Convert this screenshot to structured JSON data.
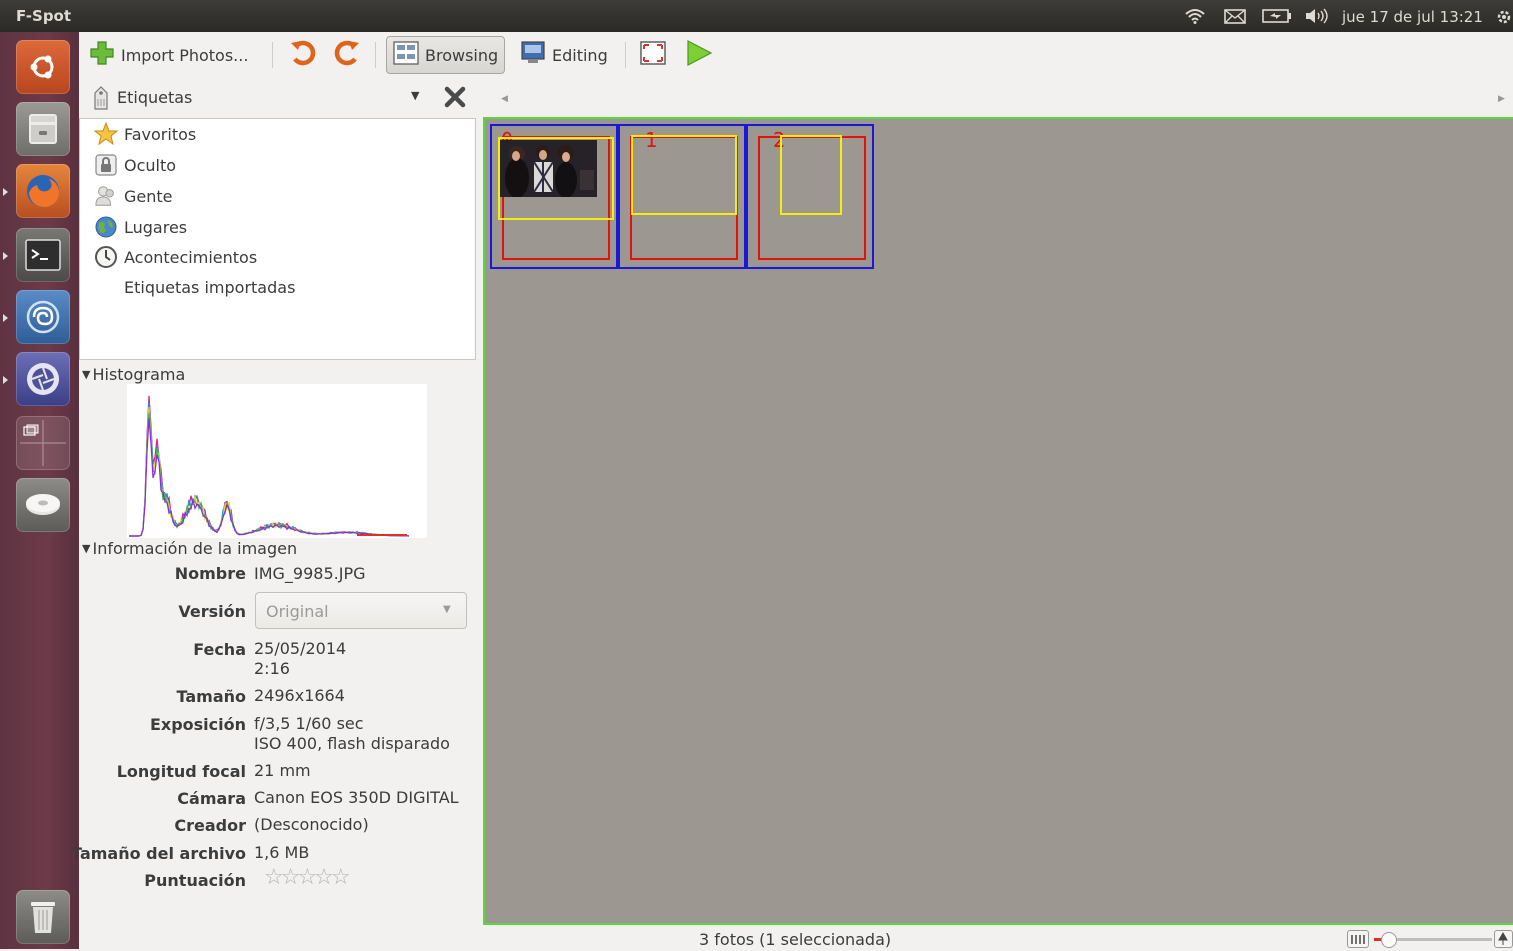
{
  "topbar": {
    "app_name": "F-Spot",
    "clock": "jue 17 de jul 13:21"
  },
  "launcher": {
    "items": [
      "ubuntu-home-icon",
      "file-cabinet-icon",
      "firefox-icon",
      "terminal-icon",
      "swirl-app-icon",
      "shutter-app-icon",
      "workspace-switcher-icon",
      "disk-drive-icon",
      "trash-icon"
    ]
  },
  "toolbar": {
    "import_label": "Import Photos...",
    "browsing_label": "Browsing",
    "editing_label": "Editing"
  },
  "tags": {
    "header_label": "Etiquetas",
    "items": [
      "Favoritos",
      "Oculto",
      "Gente",
      "Lugares",
      "Acontecimientos",
      "Etiquetas importadas"
    ]
  },
  "histogram": {
    "title": "Histograma"
  },
  "info": {
    "title": "Información de la imagen",
    "fields": [
      {
        "label": "Nombre",
        "value": "IMG_9985.JPG"
      },
      {
        "label": "Versión",
        "value": "Original"
      },
      {
        "label": "Fecha",
        "value": "25/05/2014",
        "value2": "2:16"
      },
      {
        "label": "Tamaño",
        "value": "2496x1664"
      },
      {
        "label": "Exposición",
        "value": "f/3,5 1/60 sec",
        "value2": "ISO 400, flash disparado"
      },
      {
        "label": "Longitud focal",
        "value": "21 mm"
      },
      {
        "label": "Cámara",
        "value": "Canon EOS 350D DIGITAL"
      },
      {
        "label": "Creador",
        "value": "(Desconocido)"
      },
      {
        "label": "Tamaño del archivo",
        "value": "1,6 MB"
      },
      {
        "label": "Puntuación",
        "value": "☆☆☆☆☆"
      }
    ]
  },
  "browse": {
    "cells": [
      "0",
      "1",
      "2"
    ]
  },
  "status": {
    "text": "3 fotos (1 seleccionada)"
  },
  "colors": {
    "selection_border": "#1a1ad6",
    "cell_index": "#e3120b",
    "yellow_box": "#f4ee0a",
    "browse_bg": "#9c9891",
    "focus_border": "#59d83a"
  }
}
